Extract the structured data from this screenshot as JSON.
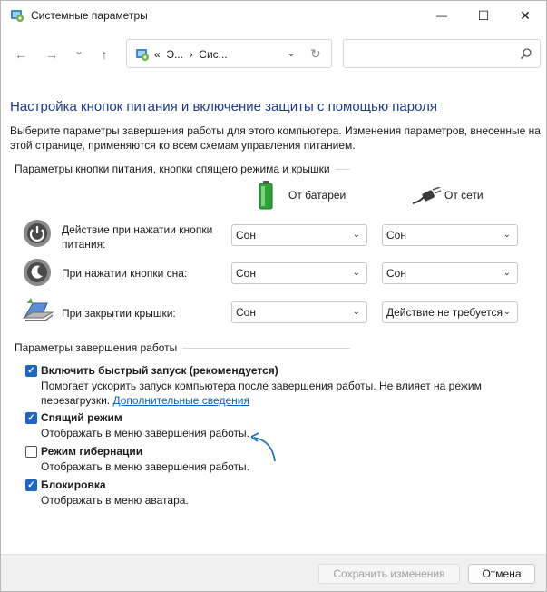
{
  "window": {
    "title": "Системные параметры",
    "minimize_glyph": "—",
    "maximize_glyph": "☐",
    "close_glyph": "✕"
  },
  "nav": {
    "back_glyph": "←",
    "forward_glyph": "→",
    "dropdown_glyph": "⌄",
    "up_glyph": "↑",
    "address_text": "«  Э...  ›  Сис...",
    "address_chevron": "⌄",
    "refresh_glyph": "↻",
    "search_placeholder": ""
  },
  "main": {
    "title": "Настройка кнопок питания и включение защиты с помощью пароля",
    "description": "Выберите параметры завершения работы для этого компьютера. Изменения параметров, внесенные на этой странице, применяются ко всем схемам управления питанием."
  },
  "power_buttons": {
    "group_label": "Параметры кнопки питания, кнопки спящего режима и крышки",
    "col_battery": "От батареи",
    "col_ac": "От сети",
    "rows": [
      {
        "label": "Действие при нажатии кнопки питания:",
        "battery": "Сон",
        "ac": "Сон",
        "icon": "power-button-icon"
      },
      {
        "label": "При нажатии кнопки сна:",
        "battery": "Сон",
        "ac": "Сон",
        "icon": "sleep-button-icon"
      },
      {
        "label": "При закрытии крышки:",
        "battery": "Сон",
        "ac": "Действие не требуется",
        "icon": "laptop-lid-icon"
      }
    ]
  },
  "shutdown": {
    "group_label": "Параметры завершения работы",
    "items": [
      {
        "label": "Включить быстрый запуск (рекомендуется)",
        "checked": true,
        "desc_line1": "Помогает ускорить запуск компьютера после завершения работы. Не влияет на режим",
        "desc_line2": "перезагрузки. ",
        "link": "Дополнительные сведения"
      },
      {
        "label": "Спящий режим",
        "checked": true,
        "desc_line1": "Отображать в меню завершения работы."
      },
      {
        "label": "Режим гибернации",
        "checked": false,
        "desc_line1": "Отображать в меню завершения работы."
      },
      {
        "label": "Блокировка",
        "checked": true,
        "desc_line1": "Отображать в меню аватара."
      }
    ],
    "check_glyph": "✓"
  },
  "footer": {
    "save_label": "Сохранить изменения",
    "cancel_label": "Отмена"
  },
  "colors": {
    "title_blue": "#1e3a8c",
    "checkbox_blue": "#1f66c4",
    "link_blue": "#0b5fc7",
    "annotation_arrow": "#1a73c9"
  }
}
